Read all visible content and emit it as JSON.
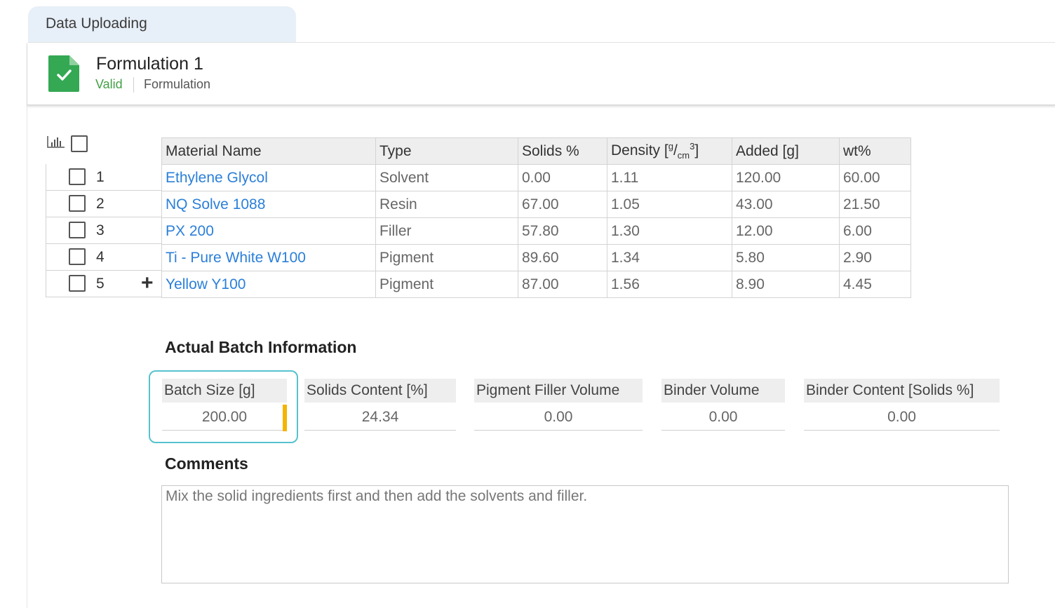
{
  "tab": {
    "label": "Data Uploading"
  },
  "header": {
    "title": "Formulation 1",
    "status": "Valid",
    "type": "Formulation",
    "icon": "valid-document-icon",
    "status_color": "#43a047"
  },
  "table": {
    "columns": {
      "material": "Material Name",
      "type": "Type",
      "solids": "Solids %",
      "density_prefix": "Density [",
      "density_num": "g",
      "density_den": "cm",
      "density_exp": "3",
      "density_suffix": "]",
      "added": "Added [g]",
      "wt": "wt%"
    },
    "rows": [
      {
        "num": "1",
        "name": "Ethylene Glycol",
        "type": "Solvent",
        "solids": "0.00",
        "density": "1.11",
        "added": "120.00",
        "wt": "60.00"
      },
      {
        "num": "2",
        "name": "NQ Solve 1088",
        "type": "Resin",
        "solids": "67.00",
        "density": "1.05",
        "added": "43.00",
        "wt": "21.50"
      },
      {
        "num": "3",
        "name": "PX 200",
        "type": "Filler",
        "solids": "57.80",
        "density": "1.30",
        "added": "12.00",
        "wt": "6.00"
      },
      {
        "num": "4",
        "name": "Ti - Pure White W100",
        "type": "Pigment",
        "solids": "89.60",
        "density": "1.34",
        "added": "5.80",
        "wt": "2.90"
      },
      {
        "num": "5",
        "name": "Yellow Y100",
        "type": "Pigment",
        "solids": "87.00",
        "density": "1.56",
        "added": "8.90",
        "wt": "4.45"
      }
    ],
    "link_color": "#2b7fd9"
  },
  "batch": {
    "title": "Actual Batch Information",
    "batch_size": {
      "label": "Batch Size [g]",
      "value": "200.00"
    },
    "solids_content": {
      "label": "Solids Content [%]",
      "value": "24.34"
    },
    "pigment_filler_volume": {
      "label": "Pigment Filler Volume",
      "value": "0.00"
    },
    "binder_volume": {
      "label": "Binder Volume",
      "value": "0.00"
    },
    "binder_content": {
      "label": "Binder Content [Solids %]",
      "value": "0.00"
    }
  },
  "comments": {
    "title": "Comments",
    "value": "Mix the solid ingredients first and then add the solvents and filler."
  }
}
